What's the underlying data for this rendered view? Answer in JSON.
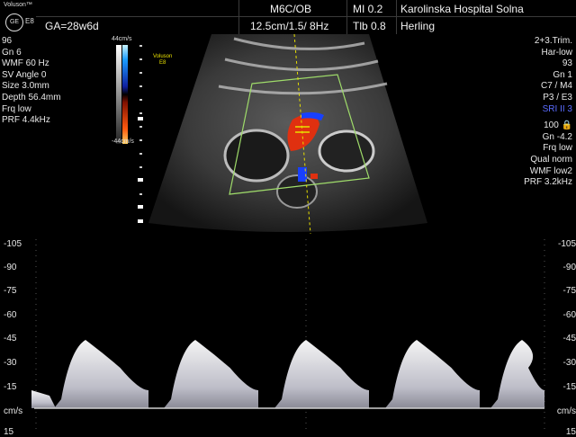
{
  "header": {
    "brand": "Voluson™",
    "logo_text": "GE",
    "model": "E8",
    "ga": "GA=28w6d",
    "probe": "M6C/OB",
    "params": "12.5cm/1.5/ 8Hz",
    "mi": "MI  0.2",
    "tib": "Tlb  0.8",
    "hospital": "Karolinska Hospital Solna",
    "operator": "Herling"
  },
  "left_panel": [
    "96",
    "Gn   6",
    "WMF 60 Hz",
    "SV Angle  0",
    "Size  3.0mm",
    "Depth 56.4mm",
    "Frq low",
    "PRF  4.4kHz"
  ],
  "colorbar": {
    "top": "44cm/s",
    "bottom": "-44cm/s"
  },
  "image_label": {
    "line1": "Voluson",
    "line2": "E8"
  },
  "right_panel": {
    "block1": [
      "2+3.Trim.",
      "Har-low",
      "93",
      "Gn   1",
      "C7 / M4",
      "P3 / E3"
    ],
    "sri": "SRI II 3",
    "block2": [
      "100 🔒",
      "Gn -4.2",
      "Frq low",
      "Qual norm",
      "WMF low2",
      "PRF  3.2kHz"
    ]
  },
  "doppler_scale": {
    "ticks": [
      "-105",
      "-90",
      "-75",
      "-60",
      "-45",
      "-30",
      "-15",
      "cm/s",
      "15"
    ]
  },
  "colors": {
    "flow_red": "#e03010",
    "flow_blue": "#1840ff",
    "roi_green": "#9fdc6a",
    "cursor_yellow": "#e8e000"
  }
}
